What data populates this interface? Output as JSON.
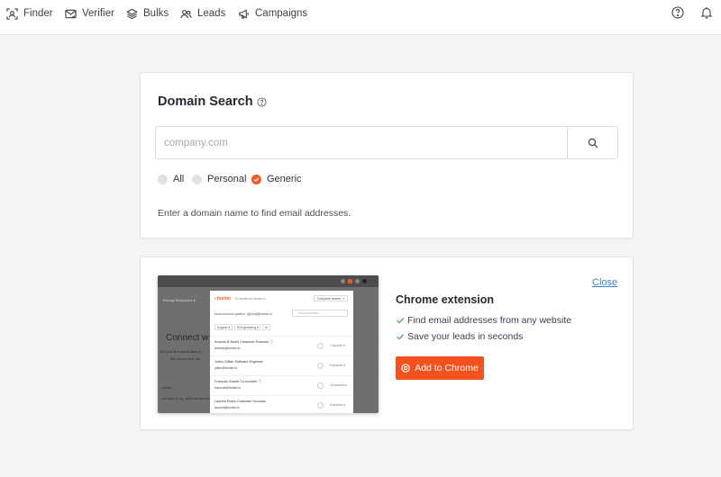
{
  "nav": {
    "items": [
      {
        "label": "Finder",
        "icon": "finder-icon"
      },
      {
        "label": "Verifier",
        "icon": "envelope-check-icon"
      },
      {
        "label": "Bulks",
        "icon": "layers-icon"
      },
      {
        "label": "Leads",
        "icon": "users-icon"
      },
      {
        "label": "Campaigns",
        "icon": "megaphone-icon"
      }
    ],
    "right_icons": [
      "help-circle-icon",
      "bell-icon"
    ]
  },
  "domain_search": {
    "title": "Domain Search",
    "input_placeholder": "company.com",
    "input_value": "",
    "filters": [
      {
        "label": "All",
        "selected": false
      },
      {
        "label": "Personal",
        "selected": false
      },
      {
        "label": "Generic",
        "selected": true
      }
    ],
    "hint": "Enter a domain name to find email addresses."
  },
  "extension": {
    "close_label": "Close",
    "title": "Chrome extension",
    "features": [
      "Find email addresses from any website",
      "Save your leads in seconds"
    ],
    "button_label": "Add to Chrome",
    "accent_color": "#f4511e",
    "check_color": "#4caf50",
    "preview": {
      "tabs": "Pricing    Resources ▾",
      "headline": "Connect w",
      "side_text_1": "and you find email addres",
      "side_text_2": "the people that ma",
      "side_text_3": "...about",
      "side_text_4": "...ail repo to ca, given email address",
      "logo": "⬪ hunter",
      "tagline": "15 results for hunter.io",
      "complete_search": "Complete search ↗",
      "pattern": "Most common pattern: {f}{last}@hunter.io",
      "search_placeholder": "Find someone...",
      "chips": [
        "Support ▾",
        "☰ Engineering ▾",
        "•••"
      ],
      "people": [
        {
          "name": "Antonio B Buehl  Customer Success  ⓘ",
          "email": "antonio@hunter.io",
          "sources": "7 sources ▾"
        },
        {
          "name": "Julien Gillian  Software Engineer",
          "email": "julien@hunter.io",
          "sources": "6 sources ▾"
        },
        {
          "name": "François Grante  Co-founder  ⓘ",
          "email": "francois@hunter.io",
          "sources": "15 sources ▾"
        },
        {
          "name": "Laurent Robin  Customer Success",
          "email": "laurent@hunter.io",
          "sources": "8 sources ▾"
        }
      ]
    }
  }
}
